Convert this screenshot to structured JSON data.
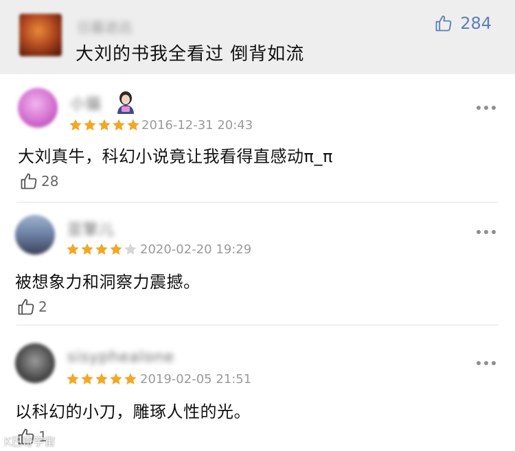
{
  "top_comment": {
    "username": "日暮途远",
    "text": "大刘的书我全看过 倒背如流",
    "likes": "284",
    "like_icon": "thumbs-up-icon"
  },
  "reviews": [
    {
      "username": "小猫",
      "rating": 5,
      "date": "2016-12-31 20:43",
      "text": "大刘真牛，科幻小说竟让我看得直感动π_π",
      "likes": "28",
      "avatar_color": "#d56fd0"
    },
    {
      "username": "亚擎儿",
      "rating": 4,
      "date": "2020-02-20 19:29",
      "text": "被想象力和洞察力震撼。",
      "likes": "2",
      "avatar_color": "#6b7fa3"
    },
    {
      "username": "sisyphealone",
      "rating": 5,
      "date": "2019-02-05 21:51",
      "text": "以科幻的小刀，雕琢人性的光。",
      "likes": "1",
      "avatar_color": "#4a4a4a"
    }
  ],
  "colors": {
    "star_active": "#f5a623",
    "star_inactive": "#d6d6d6",
    "like_blue": "#5b7fb3"
  },
  "watermark": "K巴奇宇宙"
}
